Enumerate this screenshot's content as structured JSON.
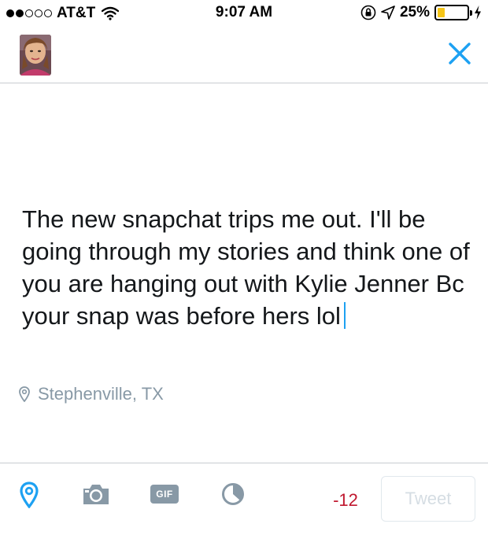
{
  "status_bar": {
    "carrier": "AT&T",
    "time": "9:07 AM",
    "battery_percent": "25%",
    "battery_level": 0.25,
    "signal_bars_filled": 2,
    "signal_bars_total": 5
  },
  "compose": {
    "text": "The new snapchat trips me out. I'll be going through my stories and think one of you are hanging out with Kylie Jenner Bc your snap was before hers lol",
    "location": "Stephenville, TX"
  },
  "toolbar": {
    "char_count": "-12",
    "tweet_label": "Tweet",
    "gif_label": "GIF"
  },
  "colors": {
    "accent": "#1da1f2",
    "icon_gray": "#8899a6",
    "error": "#c0182f",
    "battery": "#f5c518"
  },
  "icons": [
    "wifi-icon",
    "orientation-lock-icon",
    "location-services-icon",
    "close-icon",
    "location-pin-icon",
    "camera-icon",
    "gif-icon",
    "poll-icon"
  ]
}
